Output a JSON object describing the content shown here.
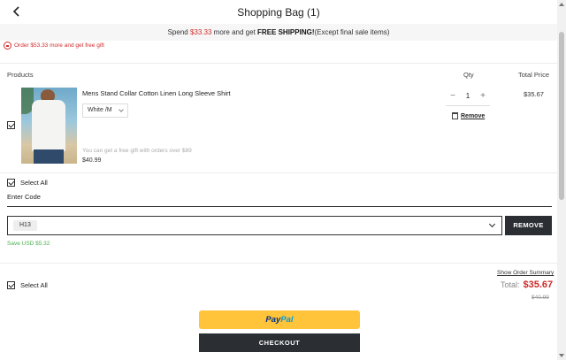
{
  "header": {
    "title": "Shopping Bag (1)"
  },
  "shipping": {
    "prefix": "Spend",
    "amount": "$33.33",
    "middle": "more and get",
    "bold": "FREE SHIPPING!",
    "suffix": "(Except final sale items)"
  },
  "gift_tip": "Order $53.33 more and get free gift",
  "columns": {
    "products": "Products",
    "qty": "Qty",
    "total_price": "Total Price"
  },
  "product": {
    "name": "Mens Stand Collar Cotton Linen Long Sleeve Shirt",
    "variant": "White /M",
    "free_gift_note": "You can get a free gift with orders over $89",
    "price": "$40.99",
    "quantity": "1",
    "minus": "−",
    "plus": "+",
    "remove_label": "Remove",
    "line_total": "$35.67"
  },
  "select_all_label": "Select All",
  "coupon": {
    "enter_code_label": "Enter Code",
    "selected_code": "H13",
    "remove_button": "REMOVE",
    "save_text": "Save USD $5.32"
  },
  "summary": {
    "show_summary_link": "Show Order Summary",
    "total_label": "Total:",
    "total_amount": "$35.67",
    "original_price": "$40.99"
  },
  "buttons": {
    "paypal_part1": "Pay",
    "paypal_part2": "Pal",
    "checkout": "CHECKOUT"
  },
  "colors": {
    "accent_red": "#d12b2b",
    "save_green": "#4caf50",
    "paypal_yellow": "#ffc439",
    "dark_button": "#2b2e33"
  }
}
